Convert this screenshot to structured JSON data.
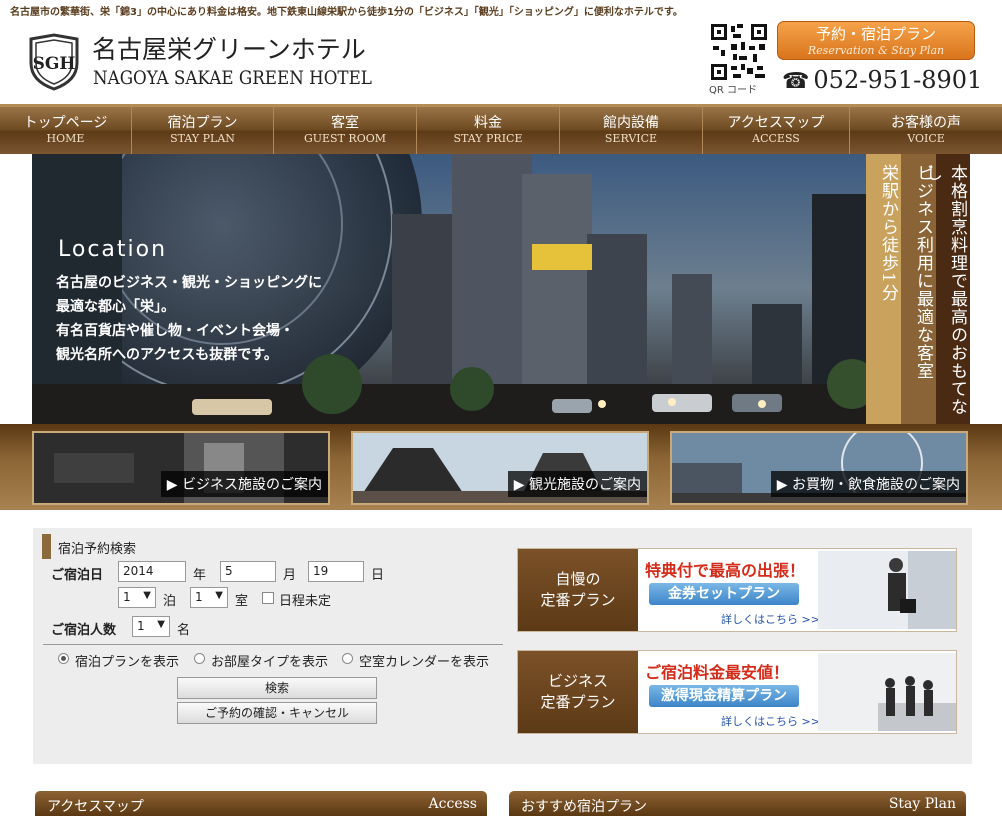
{
  "tagline": "名古屋市の繁華街、栄「錦3」の中心にあり料金は格安。地下鉄東山線栄駅から徒歩1分の「ビジネス」「観光」「ショッピング」に便利なホテルです。",
  "header": {
    "logo_text": "SGH",
    "name_jp": "名古屋栄グリーンホテル",
    "name_en": "NAGOYA SAKAE GREEN HOTEL",
    "qr_label": "QR コード",
    "reserve_jp": "予約・宿泊プラン",
    "reserve_en": "Reservation & Stay Plan",
    "phone": "052-951-8901",
    "phone_icon": "telephone-icon"
  },
  "nav": [
    {
      "jp": "トップページ",
      "en": "HOME"
    },
    {
      "jp": "宿泊プラン",
      "en": "STAY PLAN"
    },
    {
      "jp": "客室",
      "en": "GUEST ROOM"
    },
    {
      "jp": "料金",
      "en": "STAY PRICE"
    },
    {
      "jp": "館内設備",
      "en": "SERVICE"
    },
    {
      "jp": "アクセスマップ",
      "en": "ACCESS"
    },
    {
      "jp": "お客様の声",
      "en": "VOICE"
    }
  ],
  "hero": {
    "title": "Location",
    "lines": [
      "名古屋のビジネス・観光・ショッピングに",
      "最適な都心「栄」。",
      "有名百貨店や催し物・イベント会場・",
      "観光名所へのアクセスも抜群です。"
    ],
    "banners": [
      "栄駅から徒歩1分",
      "ビジネス利用に最適な客室",
      "本格割烹料理で最高のおもてなし"
    ],
    "banner_colors": [
      "#c9a25e",
      "#8a6437",
      "#4a2a12"
    ]
  },
  "categories": [
    {
      "label": "▶ ビジネス施設のご案内"
    },
    {
      "label": "▶ 観光施設のご案内"
    },
    {
      "label": "▶ お買物・飲食施設のご案内"
    }
  ],
  "search": {
    "title": "宿泊予約検索",
    "date_label": "ご宿泊日",
    "year": "2014",
    "year_unit": "年",
    "month": "5",
    "month_unit": "月",
    "day": "19",
    "day_unit": "日",
    "nights": "1",
    "nights_unit": "泊",
    "rooms": "1",
    "rooms_unit": "室",
    "undecided_label": "日程未定",
    "guests_label": "ご宿泊人数",
    "guests": "1",
    "guests_unit": "名",
    "radio1": "宿泊プランを表示",
    "radio2": "お部屋タイプを表示",
    "radio3": "空室カレンダーを表示",
    "search_btn": "検索",
    "confirm_btn": "ご予約の確認・キャンセル"
  },
  "plans": [
    {
      "left1": "自慢の",
      "left2": "定番プラン",
      "head": "特典付で最高の出張！",
      "pill": "金券セットプラン",
      "more": "詳しくはこちら >>>"
    },
    {
      "left1": "ビジネス",
      "left2": "定番プラン",
      "head": "ご宿泊料金最安値！",
      "pill": "激得現金精算プラン",
      "more": "詳しくはこちら >>>"
    }
  ],
  "sections": [
    {
      "jp": "アクセスマップ",
      "en": "Access"
    },
    {
      "jp": "おすすめ宿泊プラン",
      "en": "Stay Plan"
    }
  ]
}
